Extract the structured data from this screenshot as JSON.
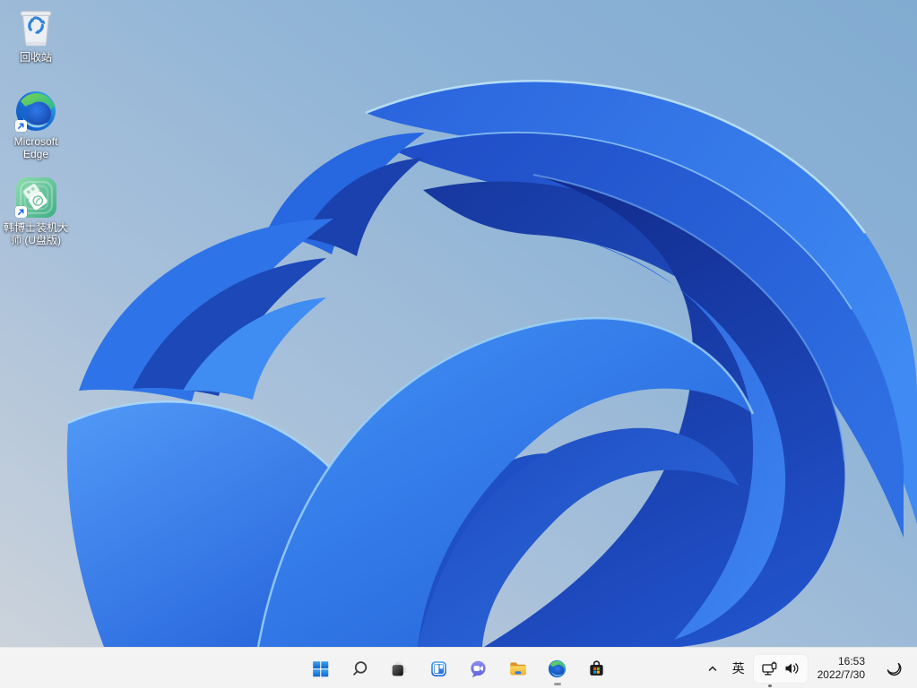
{
  "desktop": {
    "icons": [
      {
        "id": "recycle-bin",
        "label": "回收站"
      },
      {
        "id": "microsoft-edge",
        "label": "Microsoft Edge"
      },
      {
        "id": "hanboshi-usb",
        "label": "韩博士装机大师 (U盘版)"
      }
    ]
  },
  "taskbar": {
    "center_icons": [
      {
        "id": "start",
        "icon": "windows-logo"
      },
      {
        "id": "search",
        "icon": "magnifier"
      },
      {
        "id": "task-view",
        "icon": "overlapping-squares"
      },
      {
        "id": "widgets",
        "icon": "widgets-board"
      },
      {
        "id": "chat",
        "icon": "video-chat-bubble"
      },
      {
        "id": "file-explorer",
        "icon": "yellow-folder"
      },
      {
        "id": "edge",
        "icon": "edge-swirl",
        "running": true
      },
      {
        "id": "store",
        "icon": "shopping-bag"
      }
    ],
    "tray": {
      "hidden_icons_chevron": "chevron-up",
      "ime_label": "英",
      "network_icon": "ethernet-monitor",
      "volume_icon": "speaker-waves",
      "clock": {
        "time": "16:53",
        "date": "2022/7/30"
      },
      "focus_icon": "crescent-moon"
    }
  },
  "colors": {
    "taskbar_bg": "#f3f3f3",
    "wallpaper_sky_top_right": "#84aed3",
    "wallpaper_sky_bottom_left": "#ccd3db",
    "bloom_deep_blue": "#122c8e",
    "bloom_bright_blue": "#3f8af3",
    "text_dark": "#1a1a1a",
    "icon_label_text": "#ffffff"
  }
}
